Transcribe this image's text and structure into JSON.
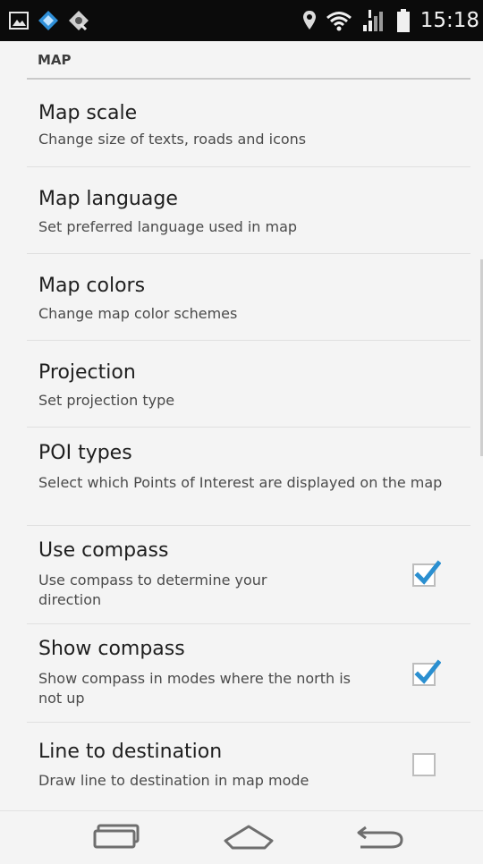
{
  "status_bar": {
    "time": "15:18",
    "left_icons": [
      "image-notification-icon",
      "app-notification-icon",
      "sync-notification-icon"
    ],
    "right_icons": [
      "location-icon",
      "wifi-icon",
      "signal-icon",
      "battery-icon"
    ]
  },
  "section": {
    "title": "MAP"
  },
  "preferences": [
    {
      "title": "Map scale",
      "summary": "Change size of texts, roads and icons"
    },
    {
      "title": "Map language",
      "summary": "Set preferred language used in map"
    },
    {
      "title": "Map colors",
      "summary": "Change map color schemes"
    },
    {
      "title": "Projection",
      "summary": "Set projection type"
    },
    {
      "title": "POI types",
      "summary": "Select which Points of Interest are displayed on the map"
    },
    {
      "title": "Use compass",
      "summary": "Use compass to determine your direction",
      "checked": true
    },
    {
      "title": "Show compass",
      "summary": "Show compass in modes where the north is not up",
      "checked": true
    },
    {
      "title": "Line to destination",
      "summary": "Draw line to destination in map mode",
      "checked": false
    }
  ],
  "nav_bar": {
    "buttons": [
      "recent-apps-icon",
      "home-icon",
      "back-icon"
    ]
  },
  "colors": {
    "accent_check": "#2a8fd0",
    "status_bar_bg": "#0b0b0b",
    "background": "#f4f4f4"
  }
}
